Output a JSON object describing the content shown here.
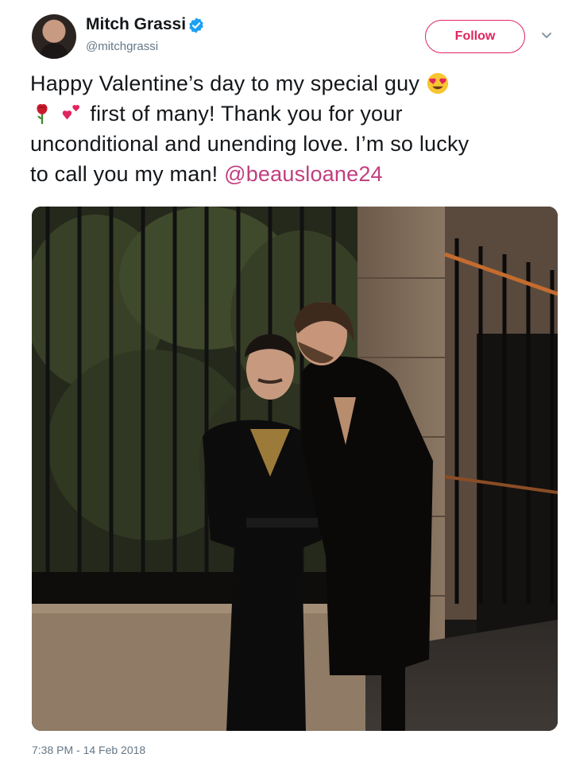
{
  "user": {
    "name": "Mitch Grassi",
    "handle": "@mitchgrassi"
  },
  "follow_button": {
    "label": "Follow"
  },
  "tweet": {
    "line1": "Happy Valentine’s day to my special guy",
    "line2": "first of many! Thank you for your",
    "line3": "unconditional and unending love. I’m so lucky",
    "line4": "to call you my man!",
    "mention": "@beausloane24",
    "emojis": [
      "heart-eyes-emoji",
      "rose-emoji",
      "two-hearts-emoji"
    ]
  },
  "timestamp": "7:38 PM - 14 Feb 2018",
  "colors": {
    "accent": "#e0245e",
    "mention": "#c13e7e",
    "verified": "#1da1f2",
    "secondary_text": "#657786"
  }
}
